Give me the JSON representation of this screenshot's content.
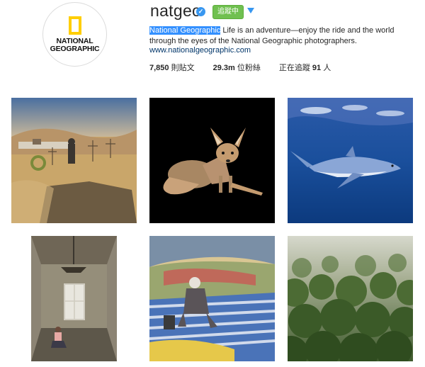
{
  "profile": {
    "logo_line1": "NATIONAL",
    "logo_line2": "GEOGRAPHIC",
    "username": "natgeo",
    "verified_mark": "✓",
    "follow_label": "追蹤中",
    "bio_highlight": "National Geographic",
    "bio_rest": " Life is an adventure—enjoy the ride and the world through the eyes of the National Geographic photographers.",
    "website": "www.nationalgeographic.com"
  },
  "stats": {
    "posts_count": "7,850",
    "posts_label": "則貼文",
    "followers_count": "29.3m",
    "followers_label": "位粉絲",
    "following_label": "正在追蹤",
    "following_count": "91",
    "following_unit": "人"
  },
  "posts": [
    {
      "subject": "desert-village-painting"
    },
    {
      "subject": "fox-on-black"
    },
    {
      "subject": "shark-underwater"
    },
    {
      "subject": "abandoned-room"
    },
    {
      "subject": "painted-hillside-woman"
    },
    {
      "subject": "rainforest-canopy"
    }
  ],
  "colors": {
    "accent_blue": "#3897f0",
    "follow_green": "#70c050",
    "link_blue": "#003569",
    "logo_yellow": "#ffce00"
  }
}
